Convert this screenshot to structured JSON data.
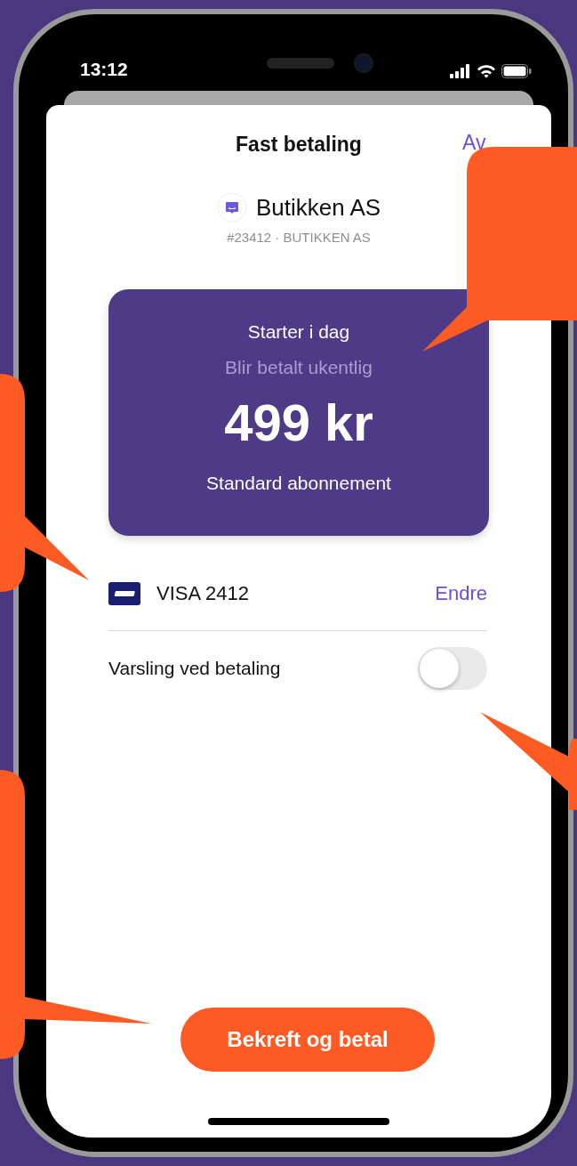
{
  "status_bar": {
    "time": "13:12"
  },
  "sheet": {
    "title": "Fast betaling",
    "cancel_label": "Av"
  },
  "merchant": {
    "name": "Butikken AS",
    "subtitle": "#23412 · BUTIKKEN AS"
  },
  "plan_card": {
    "start": "Starter i dag",
    "frequency": "Blir betalt ukentlig",
    "amount": "499 kr",
    "plan": "Standard abonnement"
  },
  "payment_method": {
    "card": "VISA 2412",
    "change_label": "Endre"
  },
  "notification": {
    "label": "Varsling ved betaling",
    "on": false
  },
  "confirm_button": {
    "label": "Bekreft og betal"
  }
}
